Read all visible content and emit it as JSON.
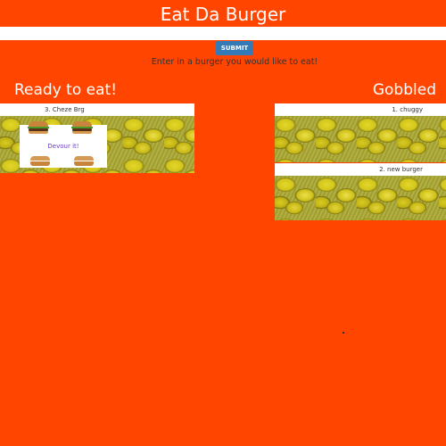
{
  "header": {
    "title": "Eat Da Burger"
  },
  "form": {
    "input_value": "",
    "submit_label": "SUBMIT",
    "helper_text": "Enter in a burger you would like to eat!"
  },
  "ready": {
    "heading": "Ready to eat!",
    "burgers": [
      {
        "label": "3. Cheze Brg",
        "action_label": "Devour it!"
      }
    ]
  },
  "gobbled": {
    "heading": "Gobbled",
    "burgers": [
      {
        "label": "1. chuggy"
      },
      {
        "label": "2. new burger"
      }
    ]
  }
}
